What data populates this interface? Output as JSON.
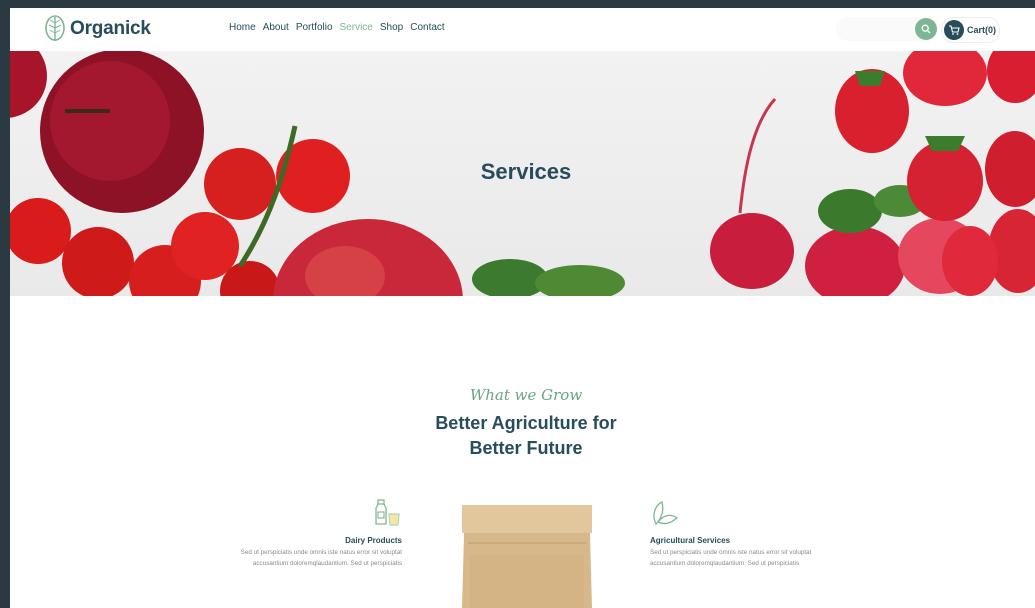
{
  "header": {
    "brand": "Organick",
    "nav": [
      {
        "label": "Home",
        "active": false
      },
      {
        "label": "About",
        "active": false
      },
      {
        "label": "Portfolio",
        "active": false
      },
      {
        "label": "Service",
        "active": true
      },
      {
        "label": "Shop",
        "active": false
      },
      {
        "label": "Contact",
        "active": false
      }
    ],
    "search_placeholder": "",
    "cart_label": "Cart(0)"
  },
  "hero": {
    "title": "Services"
  },
  "section": {
    "eyebrow": "What we Grow",
    "headline_line1": "Better Agriculture for",
    "headline_line2": "Better Future"
  },
  "services": [
    {
      "title": "Dairy Products",
      "desc": "Sed ut perspiciatis unde omnis iste natus error sit voluptat accusantium doloremqlaudantium. Sed ut perspiciatis"
    },
    {
      "title": "Agricultural Services",
      "desc": "Sed ut perspiciatis unde omnis iste natus error sit voluptat accusantium doloremqlaudantium. Sed ut perspiciatis"
    }
  ],
  "colors": {
    "primary": "#274c5b",
    "accent": "#7eb693",
    "eyebrow": "#68a47f"
  },
  "icons": [
    "leaf-logo-icon",
    "search-icon",
    "cart-icon",
    "dairy-bottle-icon",
    "leaves-icon"
  ]
}
